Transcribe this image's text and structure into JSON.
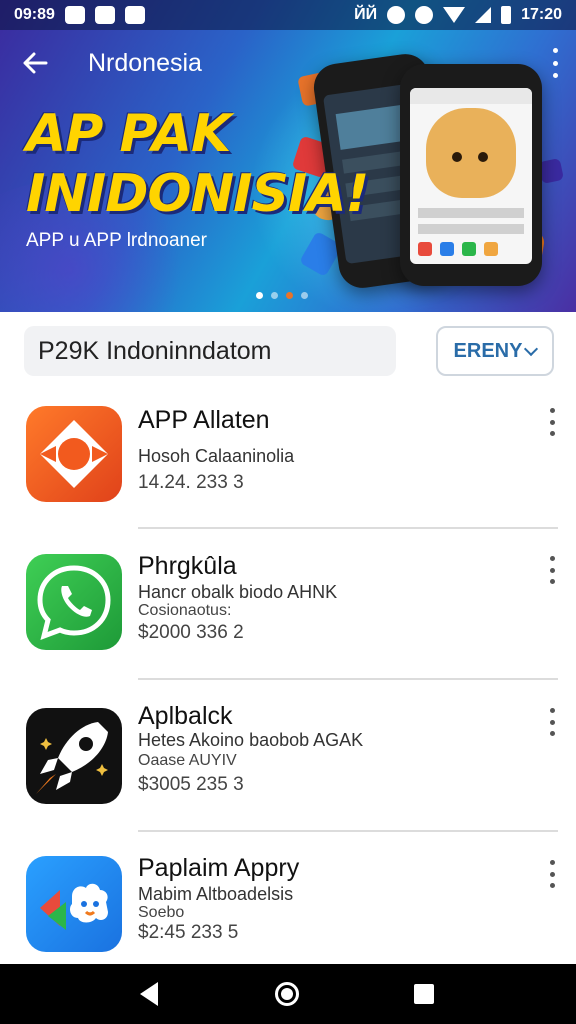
{
  "status_bar": {
    "time_left": "09:89",
    "time_right": "17:20",
    "vibrate_text": "ЙЙ"
  },
  "app_bar": {
    "back_icon": "arrow-left-icon",
    "title": "Nrdonesia",
    "menu_icon": "overflow-menu-icon"
  },
  "banner": {
    "headline_line1": "AP PAK",
    "headline_line2": "INIDONISIA!",
    "subtitle": "APP u APP lrdnoaner",
    "page_count": 4,
    "active_page": 0,
    "colors": {
      "headline": "#ffd400",
      "gradient_start": "#3b2a9e",
      "gradient_mid": "#1aa0d8"
    }
  },
  "search": {
    "value": "P29K  Indoninndatom",
    "filter_label": "ERENY"
  },
  "apps": [
    {
      "name": "APP Allaten",
      "subtitle": "Hosoh Calaaninolia",
      "extra": "",
      "meta": "14.24. 233  3",
      "icon": "orange-diamond-icon",
      "icon_color": "#f25a1e"
    },
    {
      "name": "Phrgkûla",
      "subtitle": "Hancr obalk biodo AHNK",
      "extra": "Cosionaotus:",
      "meta": "$2000  336  2",
      "icon": "phone-chat-icon",
      "icon_color": "#2bb64a"
    },
    {
      "name": "Aplbalck",
      "subtitle": "Hetes Akoino baobob AGAK",
      "extra": "Oaase AUYIV",
      "meta": "$3005  235  3",
      "icon": "rocket-icon",
      "icon_color": "#111111"
    },
    {
      "name": "Paplaim Appry",
      "subtitle": "Mabim Altboadelsis",
      "extra": "Soebo",
      "meta": "$2:45  233  5",
      "icon": "puzzle-cloud-icon",
      "icon_color": "#1e8cf0"
    }
  ],
  "nav_bar": {
    "back_icon": "nav-back-icon",
    "home_icon": "nav-home-icon",
    "recents_icon": "nav-recents-icon"
  }
}
